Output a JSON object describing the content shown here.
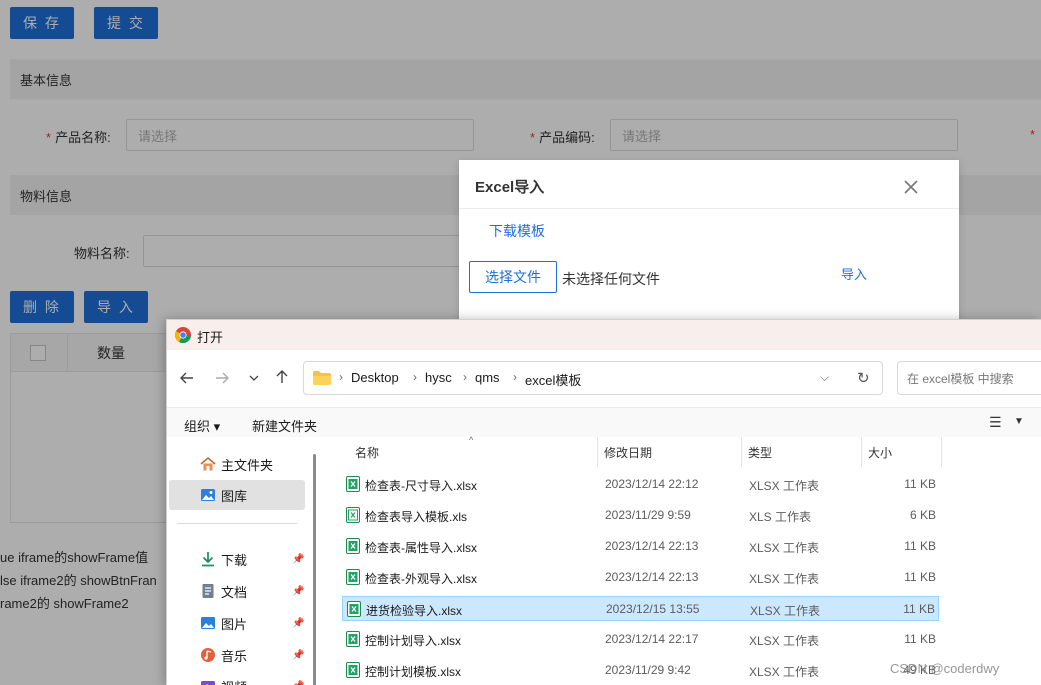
{
  "form": {
    "save_label": "保 存",
    "submit_label": "提 交",
    "basic_section": "基本信息",
    "product_name_label": "产品名称:",
    "product_name_placeholder": "请选择",
    "product_code_label": "产品编码:",
    "product_code_placeholder": "请选择",
    "material_section": "物料信息",
    "material_name_label": "物料名称:",
    "delete_label": "删 除",
    "import_label": "导 入",
    "table_header_qty": "数量",
    "code_lines": [
      "ue iframe的showFrame值",
      "lse iframe2的 showBtnFran",
      "rame2的 showFrame2"
    ]
  },
  "excel_modal": {
    "title": "Excel导入",
    "download_template": "下载模板",
    "choose_file": "选择文件",
    "no_file": "未选择任何文件",
    "import": "导入"
  },
  "file_dialog": {
    "title": "打开",
    "path": [
      "Desktop",
      "hysc",
      "qms",
      "excel模板"
    ],
    "search_placeholder": "在 excel模板 中搜索",
    "organize": "组织 ▾",
    "new_folder": "新建文件夹",
    "sidebar": [
      {
        "label": "主文件夹",
        "icon": "home-icon",
        "pinned": false
      },
      {
        "label": "图库",
        "icon": "gallery-icon",
        "pinned": false,
        "selected": true
      },
      {
        "label": "下载",
        "icon": "download-icon",
        "pinned": true
      },
      {
        "label": "文档",
        "icon": "document-icon",
        "pinned": true
      },
      {
        "label": "图片",
        "icon": "picture-icon",
        "pinned": true
      },
      {
        "label": "音乐",
        "icon": "music-icon",
        "pinned": true
      },
      {
        "label": "视频",
        "icon": "video-icon",
        "pinned": true
      }
    ],
    "columns": {
      "name": "名称",
      "date": "修改日期",
      "type": "类型",
      "size": "大小"
    },
    "files": [
      {
        "name": "检查表-尺寸导入.xlsx",
        "date": "2023/12/14 22:12",
        "type": "XLSX 工作表",
        "size": "11 KB"
      },
      {
        "name": "检查表导入模板.xls",
        "date": "2023/11/29 9:59",
        "type": "XLS 工作表",
        "size": "6 KB"
      },
      {
        "name": "检查表-属性导入.xlsx",
        "date": "2023/12/14 22:13",
        "type": "XLSX 工作表",
        "size": "11 KB"
      },
      {
        "name": "检查表-外观导入.xlsx",
        "date": "2023/12/14 22:13",
        "type": "XLSX 工作表",
        "size": "11 KB"
      },
      {
        "name": "进货检验导入.xlsx",
        "date": "2023/12/15 13:55",
        "type": "XLSX 工作表",
        "size": "11 KB",
        "selected": true
      },
      {
        "name": "控制计划导入.xlsx",
        "date": "2023/12/14 22:17",
        "type": "XLSX 工作表",
        "size": "11 KB"
      },
      {
        "name": "控制计划模板.xlsx",
        "date": "2023/11/29 9:42",
        "type": "XLSX 工作表",
        "size": "49 KB"
      }
    ]
  },
  "watermark": "CSDN @coderdwy",
  "colors": {
    "primary": "#1e6fd9",
    "selected_row": "#cce8ff",
    "titlebar": "#f8efed"
  }
}
